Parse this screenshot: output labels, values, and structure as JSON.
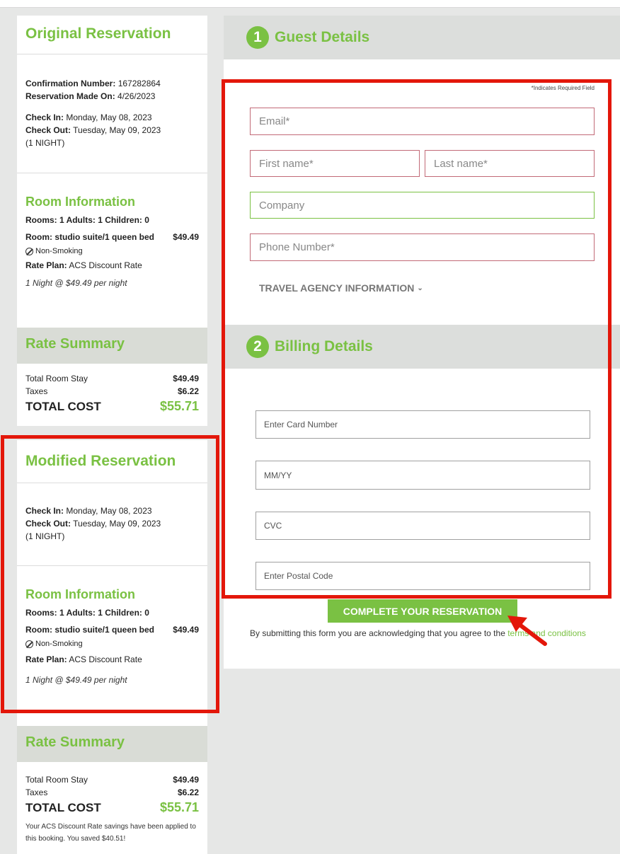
{
  "original": {
    "title": "Original Reservation",
    "confirmation_label": "Confirmation Number:",
    "confirmation_value": "167282864",
    "made_label": "Reservation Made On:",
    "made_value": "4/26/2023",
    "checkin_label": "Check In:",
    "checkin_value": "Monday, May 08, 2023",
    "checkout_label": "Check Out:",
    "checkout_value": "Tuesday, May 09, 2023",
    "nights": "(1 NIGHT)",
    "room_heading": "Room Information",
    "rooms_line": "Rooms: 1 Adults: 1 Children: 0",
    "room_label": "Room: studio suite/1 queen bed",
    "room_price": "$49.49",
    "smoking": "Non-Smoking",
    "rate_label": "Rate Plan:",
    "rate_value": "ACS Discount Rate",
    "per_night": "1 Night @ $49.49 per night",
    "rate_summary": "Rate Summary",
    "stay_label": "Total Room Stay",
    "stay_value": "$49.49",
    "tax_label": "Taxes",
    "tax_value": "$6.22",
    "total_label": "TOTAL COST",
    "total_value": "$55.71"
  },
  "modified": {
    "title": "Modified Reservation",
    "checkin_label": "Check In:",
    "checkin_value": "Monday, May 08, 2023",
    "checkout_label": "Check Out:",
    "checkout_value": "Tuesday, May 09, 2023",
    "nights": "(1 NIGHT)",
    "room_heading": "Room Information",
    "rooms_line": "Rooms: 1 Adults: 1 Children: 0",
    "room_label": "Room: studio suite/1 queen bed",
    "room_price": "$49.49",
    "smoking": "Non-Smoking",
    "rate_label": "Rate Plan:",
    "rate_value": "ACS Discount Rate",
    "per_night": "1 Night @ $49.49 per night",
    "rate_summary": "Rate Summary",
    "stay_label": "Total Room Stay",
    "stay_value": "$49.49",
    "tax_label": "Taxes",
    "tax_value": "$6.22",
    "total_label": "TOTAL COST",
    "total_value": "$55.71",
    "savings": "Your ACS Discount Rate savings have been applied to this booking. You saved $40.51!"
  },
  "guest": {
    "step": "1",
    "title": "Guest Details",
    "required_note": "*Indicates Required Field",
    "email_ph": "Email*",
    "first_ph": "First name*",
    "last_ph": "Last name*",
    "company_ph": "Company",
    "phone_ph": "Phone Number*",
    "travel_agency": "TRAVEL AGENCY INFORMATION"
  },
  "billing": {
    "step": "2",
    "title": "Billing Details",
    "card_ph": "Enter Card Number",
    "exp_ph": "MM/YY",
    "cvc_ph": "CVC",
    "postal_ph": "Enter Postal Code"
  },
  "submit": {
    "button": "COMPLETE YOUR RESERVATION",
    "terms_prefix": "By submitting this form you are acknowledging that you agree to the ",
    "terms_link": "terms and conditions"
  },
  "colors": {
    "accent": "#7ac143",
    "annotation": "#e3170a"
  }
}
